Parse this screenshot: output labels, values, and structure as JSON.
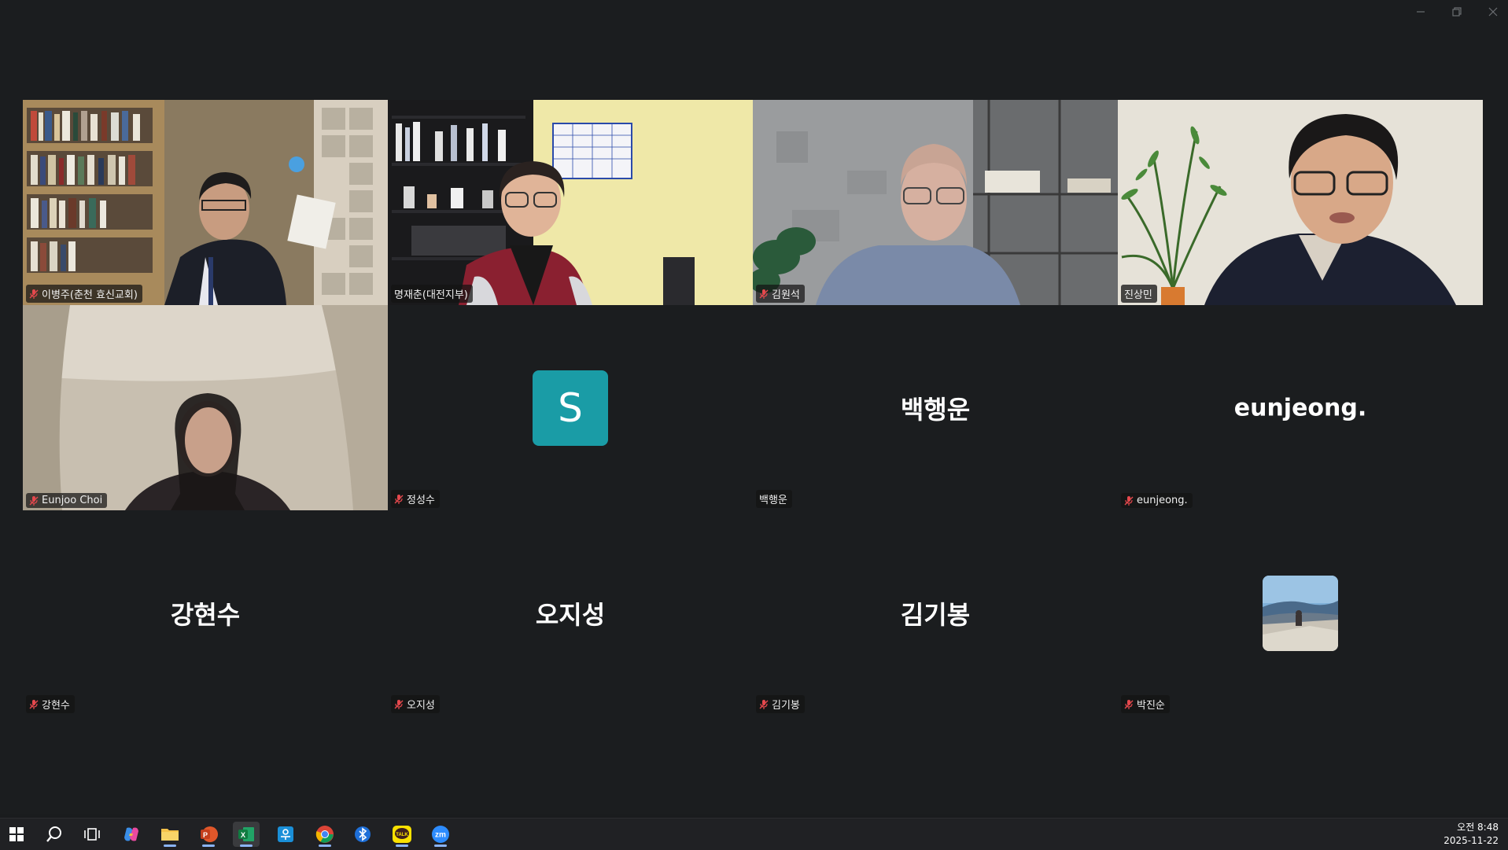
{
  "window": {
    "controls": [
      "minimize",
      "restore",
      "close"
    ]
  },
  "participants": [
    {
      "name": "이병주(춘천 효신교회)",
      "muted": true,
      "video": true
    },
    {
      "name": "명재춘(대전지부)",
      "muted": false,
      "video": true
    },
    {
      "name": "김원석",
      "muted": true,
      "video": true
    },
    {
      "name": "진상민",
      "muted": false,
      "video": true,
      "speaking": true
    },
    {
      "name": "Eunjoo Choi",
      "muted": true,
      "video": true
    },
    {
      "name": "정성수",
      "muted": true,
      "video": false,
      "avatar_letter": "S",
      "avatar_color": "#1a9ca6"
    },
    {
      "name": "백행운",
      "muted": false,
      "video": false,
      "display_name": "백행운"
    },
    {
      "name": "eunjeong.",
      "muted": true,
      "video": false,
      "display_name": "eunjeong."
    },
    {
      "name": "강현수",
      "muted": true,
      "video": false,
      "display_name": "강현수"
    },
    {
      "name": "오지성",
      "muted": true,
      "video": false,
      "display_name": "오지성"
    },
    {
      "name": "김기봉",
      "muted": true,
      "video": false,
      "display_name": "김기봉"
    },
    {
      "name": "박진순",
      "muted": true,
      "video": false,
      "avatar_photo": true
    }
  ],
  "colors": {
    "background": "#1b1d1f",
    "active_speaker_border": "#2bd08a",
    "muted_icon": "#e5484d"
  },
  "taskbar": {
    "icons": [
      "windows-start-icon",
      "search-icon",
      "task-view-icon",
      "copilot-icon",
      "file-explorer-icon",
      "powerpoint-icon",
      "excel-icon",
      "hangul-icon",
      "chrome-icon",
      "bluetooth-app-icon",
      "kakaotalk-icon",
      "zoom-icon"
    ],
    "kakao_label": "TALK",
    "zoom_label": "zm",
    "clock_time": "오전 8:48",
    "clock_date": "2025-11-22"
  }
}
